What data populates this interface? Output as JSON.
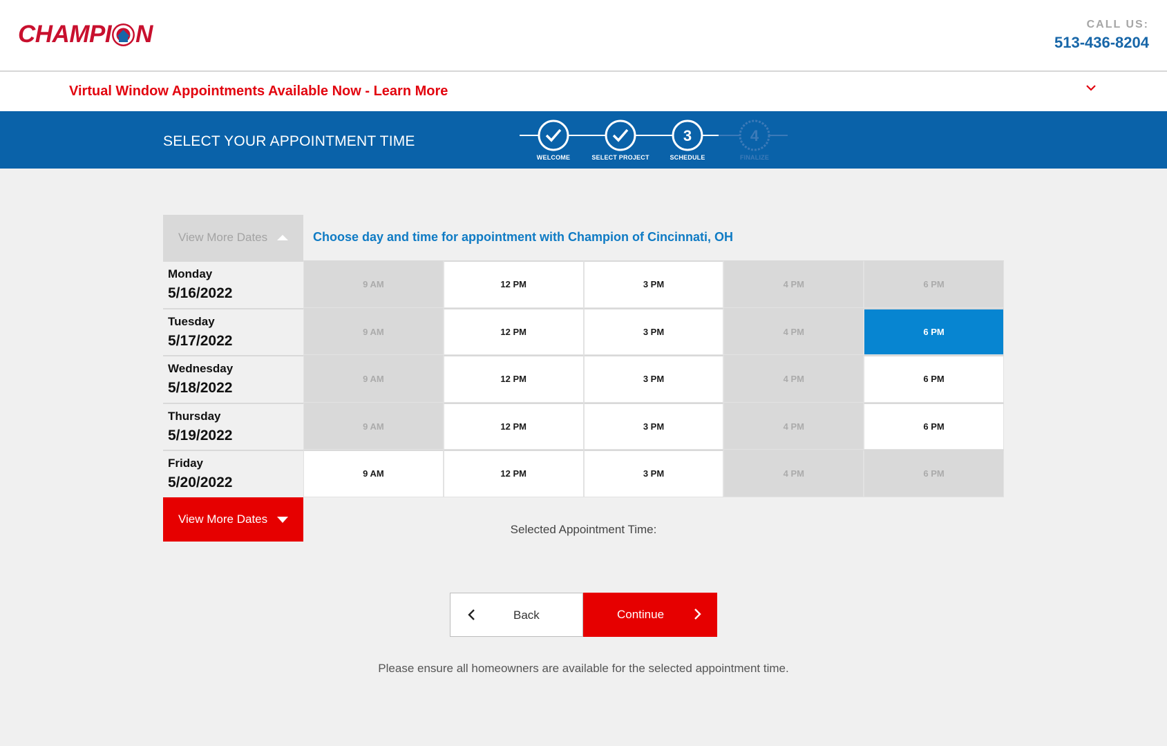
{
  "header": {
    "logo_text": "CHAMPION",
    "call_label": "CALL US:",
    "phone": "513-436-8204"
  },
  "banner": {
    "text": "Virtual Window Appointments Available Now - Learn More"
  },
  "stepbar": {
    "title": "SELECT YOUR APPOINTMENT TIME",
    "steps": [
      {
        "label": "WELCOME",
        "state": "complete"
      },
      {
        "label": "SELECT PROJECT",
        "state": "complete"
      },
      {
        "label": "SCHEDULE",
        "state": "current",
        "number": "3"
      },
      {
        "label": "FINALIZE",
        "state": "upcoming",
        "number": "4"
      }
    ]
  },
  "schedule": {
    "view_more_top": "View More Dates",
    "heading": "Choose day and time for appointment with Champion of Cincinnati, OH",
    "days": [
      {
        "name": "Monday",
        "date": "5/16/2022",
        "slots": [
          {
            "time": "9 AM",
            "state": "unavailable"
          },
          {
            "time": "12 PM",
            "state": "available"
          },
          {
            "time": "3 PM",
            "state": "available"
          },
          {
            "time": "4 PM",
            "state": "unavailable"
          },
          {
            "time": "6 PM",
            "state": "unavailable"
          }
        ]
      },
      {
        "name": "Tuesday",
        "date": "5/17/2022",
        "slots": [
          {
            "time": "9 AM",
            "state": "unavailable"
          },
          {
            "time": "12 PM",
            "state": "available"
          },
          {
            "time": "3 PM",
            "state": "available"
          },
          {
            "time": "4 PM",
            "state": "unavailable"
          },
          {
            "time": "6 PM",
            "state": "selected"
          }
        ]
      },
      {
        "name": "Wednesday",
        "date": "5/18/2022",
        "slots": [
          {
            "time": "9 AM",
            "state": "unavailable"
          },
          {
            "time": "12 PM",
            "state": "available"
          },
          {
            "time": "3 PM",
            "state": "available"
          },
          {
            "time": "4 PM",
            "state": "unavailable"
          },
          {
            "time": "6 PM",
            "state": "available"
          }
        ]
      },
      {
        "name": "Thursday",
        "date": "5/19/2022",
        "slots": [
          {
            "time": "9 AM",
            "state": "unavailable"
          },
          {
            "time": "12 PM",
            "state": "available"
          },
          {
            "time": "3 PM",
            "state": "available"
          },
          {
            "time": "4 PM",
            "state": "unavailable"
          },
          {
            "time": "6 PM",
            "state": "available"
          }
        ]
      },
      {
        "name": "Friday",
        "date": "5/20/2022",
        "slots": [
          {
            "time": "9 AM",
            "state": "available"
          },
          {
            "time": "12 PM",
            "state": "available"
          },
          {
            "time": "3 PM",
            "state": "available"
          },
          {
            "time": "4 PM",
            "state": "unavailable"
          },
          {
            "time": "6 PM",
            "state": "unavailable"
          }
        ]
      }
    ],
    "view_more_bottom": "View More Dates",
    "selected_label": "Selected Appointment Time:"
  },
  "actions": {
    "back_label": "Back",
    "continue_label": "Continue"
  },
  "note": "Please ensure all homeowners are available for the selected appointment time.",
  "colors": {
    "brand_red": "#e60000",
    "brand_blue": "#0a62a9",
    "selected_blue": "#0785d1",
    "heading_blue": "#0f7bc4"
  }
}
